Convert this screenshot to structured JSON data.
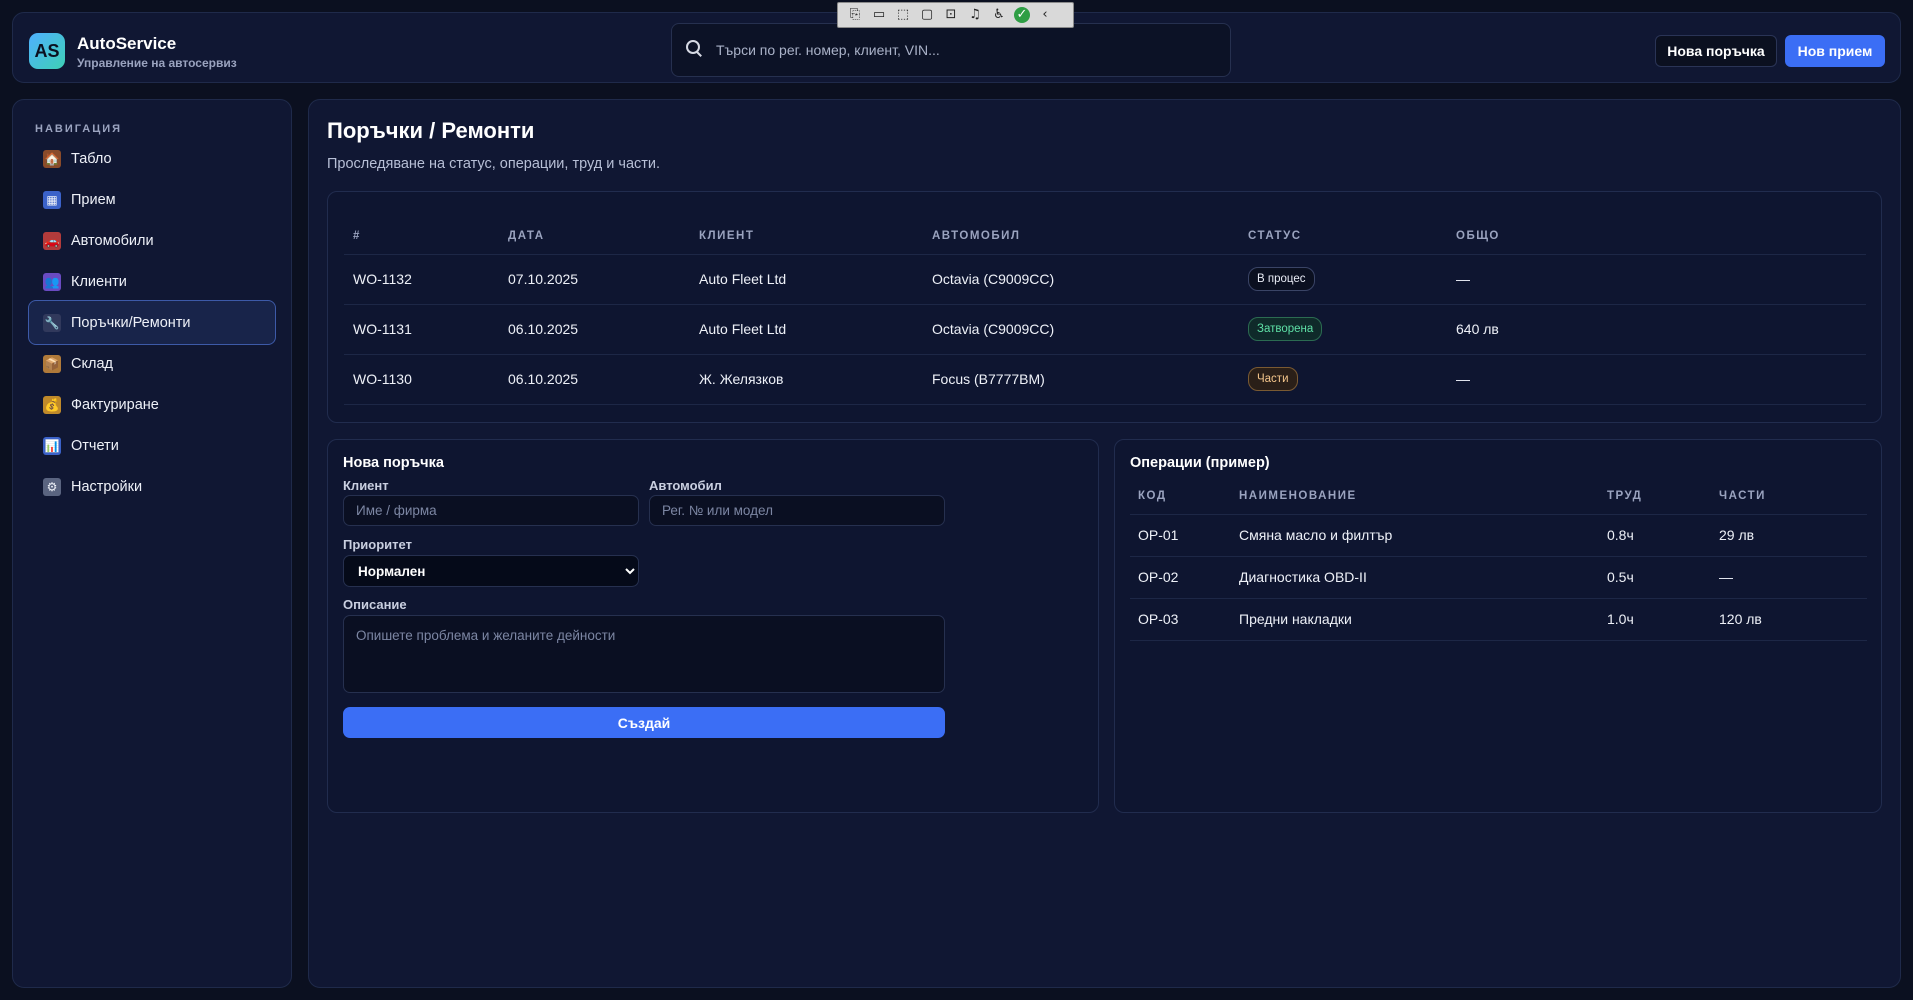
{
  "devtools": {
    "icons": [
      "cursor-icon",
      "camera-icon",
      "select-icon",
      "frame-icon",
      "hover-icon",
      "audio-icon",
      "accessibility-icon",
      "check-icon",
      "collapse-icon"
    ],
    "glyphs": [
      "⎘",
      "▭",
      "⬚",
      "▢",
      "⊡",
      "♫",
      "♿",
      "✓",
      "‹"
    ]
  },
  "header": {
    "logo_text": "AS",
    "title": "AutoService",
    "subtitle": "Управление на автосервиз",
    "search_placeholder": "Търси по рег. номер, клиент, VIN...",
    "btn_new_order": "Нова поръчка",
    "btn_new_intake": "Нов прием"
  },
  "sidebar": {
    "heading": "НАВИГАЦИЯ",
    "items": [
      {
        "label": "Табло",
        "icon": "🏠",
        "icon_name": "home-icon"
      },
      {
        "label": "Прием",
        "icon": "▦",
        "icon_name": "calendar-icon"
      },
      {
        "label": "Автомобили",
        "icon": "🚗",
        "icon_name": "car-icon"
      },
      {
        "label": "Клиенти",
        "icon": "👥",
        "icon_name": "users-icon"
      },
      {
        "label": "Поръчки/Ремонти",
        "icon": "🔧",
        "icon_name": "wrench-icon"
      },
      {
        "label": "Склад",
        "icon": "📦",
        "icon_name": "box-icon"
      },
      {
        "label": "Фактуриране",
        "icon": "💰",
        "icon_name": "money-bag-icon"
      },
      {
        "label": "Отчети",
        "icon": "📊",
        "icon_name": "chart-icon"
      },
      {
        "label": "Настройки",
        "icon": "⚙",
        "icon_name": "gear-icon"
      }
    ],
    "active_index": 4
  },
  "main": {
    "title": "Поръчки / Ремонти",
    "subtitle": "Проследяване на статус, операции, труд и части.",
    "orders": {
      "columns": [
        "#",
        "ДАТА",
        "КЛИЕНТ",
        "АВТОМОБИЛ",
        "СТАТУС",
        "ОБЩО"
      ],
      "rows": [
        {
          "id": "WO-1132",
          "date": "07.10.2025",
          "client": "Auto Fleet Ltd",
          "car": "Octavia (C9009CC)",
          "status": "В процес",
          "status_kind": "progress",
          "total": "—"
        },
        {
          "id": "WO-1131",
          "date": "06.10.2025",
          "client": "Auto Fleet Ltd",
          "car": "Octavia (C9009CC)",
          "status": "Затворена",
          "status_kind": "closed",
          "total": "640 лв"
        },
        {
          "id": "WO-1130",
          "date": "06.10.2025",
          "client": "Ж. Желязков",
          "car": "Focus (B7777BM)",
          "status": "Части",
          "status_kind": "parts",
          "total": "—"
        }
      ]
    },
    "new_order": {
      "title": "Нова поръчка",
      "client_label": "Клиент",
      "client_placeholder": "Име / фирма",
      "car_label": "Автомобил",
      "car_placeholder": "Рег. № или модел",
      "priority_label": "Приоритет",
      "priority_value": "Нормален",
      "description_label": "Описание",
      "description_placeholder": "Опишете проблема и желаните дейности",
      "create_button": "Създай"
    },
    "operations": {
      "title": "Операции (пример)",
      "columns": [
        "КОД",
        "НАИМЕНОВАНИЕ",
        "ТРУД",
        "ЧАСТИ"
      ],
      "rows": [
        {
          "code": "OP-01",
          "name": "Смяна масло и филтър",
          "labor": "0.8ч",
          "parts": "29 лв"
        },
        {
          "code": "OP-02",
          "name": "Диагностика OBD-II",
          "labor": "0.5ч",
          "parts": "—"
        },
        {
          "code": "OP-03",
          "name": "Предни накладки",
          "labor": "1.0ч",
          "parts": "120 лв"
        }
      ]
    }
  },
  "colors": {
    "background": "#0b1020",
    "panel": "#101733",
    "accent": "#3b6ef5",
    "status_closed": "#5ee0a6",
    "status_parts": "#f3c58b"
  }
}
